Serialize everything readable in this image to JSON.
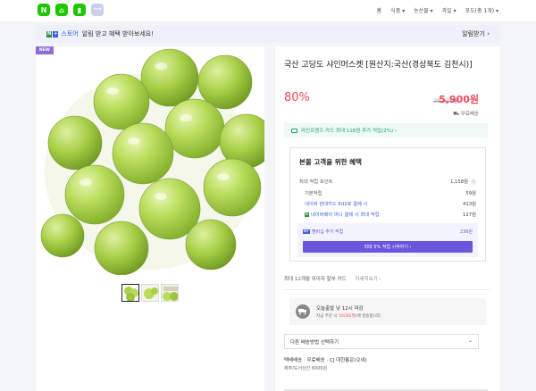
{
  "nav": {
    "icons": [
      {
        "name": "naver-logo-icon",
        "glyph": "N",
        "color": "#1ec800"
      },
      {
        "name": "home-icon",
        "glyph": "⌂",
        "color": "#1ec800"
      },
      {
        "name": "bookmark-icon",
        "glyph": "▮",
        "color": "#1ec800"
      },
      {
        "name": "more-icon",
        "glyph": "•••",
        "color": "#c9cfe8"
      }
    ],
    "breadcrumb": [
      "홈",
      "식품 ▾",
      "농산물 ▾",
      "과일 ▾",
      "포도(총 1개) ▾"
    ]
  },
  "banner": {
    "npay_n": "N",
    "npay_p": "+",
    "store": "스토어",
    "message": "알림 받고 혜택 받아보세요!",
    "button": "알림받기 ›"
  },
  "product": {
    "badge": "NEW",
    "title": "국산 고당도 샤인머스켓 [원산지:국산(경상북도 김천시)]",
    "discount": "80%",
    "original_price": "29,900원",
    "price": "5,900원",
    "shipping": "무료배송"
  },
  "card_promo": {
    "text": "라인프렌즈 카드 최대 118원 추가 적립(2%) ›"
  },
  "benefit": {
    "title": "본몰 고객을 위한 혜택",
    "rows": [
      {
        "label": "최대 적립 포인트",
        "value": "1,158원"
      },
      {
        "label": "기본적립",
        "value": "59원"
      },
      {
        "label": "네이버 현대카드 Ed2로 결제 시",
        "value": "413원"
      },
      {
        "label": "네이버페이 머니 결제 시 최대 적립",
        "value": "117원"
      }
    ],
    "member_label": "멤버십 추가 적립",
    "member_value": "236원",
    "member_button": "최대 5% 적립 시작하기 ›"
  },
  "installment": {
    "text": "최대 12개월 무이자 할부 카드",
    "more": "자세히보기 ›"
  },
  "delivery": {
    "title": "오늘출발 낮 12시 마감",
    "sub_prefix": "지금 주문 시 ",
    "sub_highlight": "10/26(월)",
    "sub_suffix": "에 발송합니다."
  },
  "ship_select": {
    "label": "다른 배송방법 선택하기"
  },
  "ship_info": {
    "line1": "택배배송 · 무료배송 · CJ 대한통운(오네)",
    "line2": "제주/도서산간 6000원"
  }
}
